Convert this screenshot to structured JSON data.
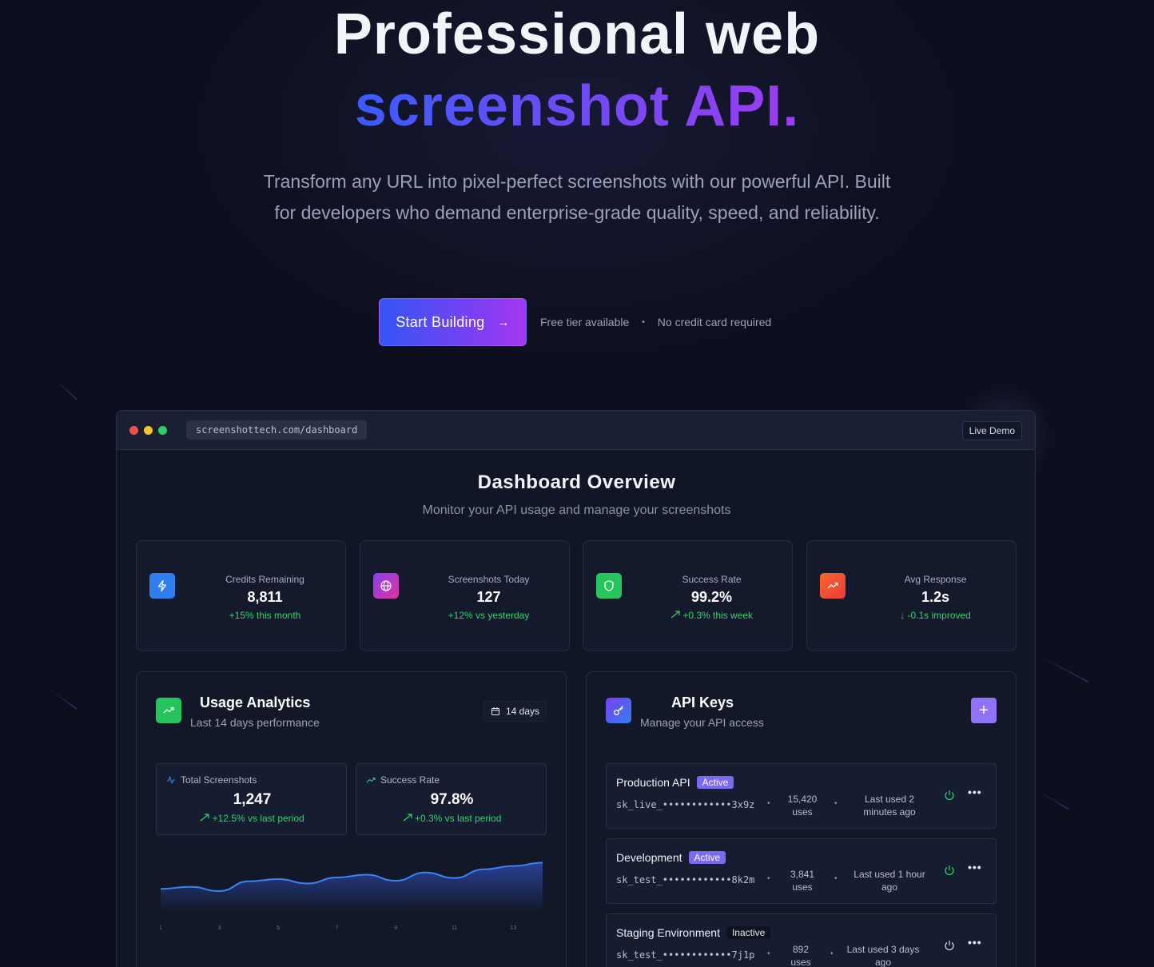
{
  "hero": {
    "title_line1": "Professional web",
    "title_line2": "screenshot API.",
    "subtitle": "Transform any URL into pixel-perfect screenshots with our powerful API. Built for developers who demand enterprise-grade quality, speed, and reliability.",
    "cta_label": "Start Building",
    "cta_arrow": "→",
    "note1": "Free tier available",
    "note_sep": "•",
    "note2": "No credit card required"
  },
  "browser": {
    "url": "screenshottech.com/dashboard",
    "live_demo": "Live Demo",
    "traffic_colors": [
      "#f04e4e",
      "#f4c430",
      "#2fcf67"
    ]
  },
  "dashboard": {
    "title": "Dashboard Overview",
    "subtitle": "Monitor your API usage and manage your screenshots"
  },
  "stats": [
    {
      "label": "Credits Remaining",
      "value": "8,811",
      "change": "+15% this month",
      "icon": "bolt-icon",
      "color": "#2f7ff0"
    },
    {
      "label": "Screenshots Today",
      "value": "127",
      "change": "+12% vs yesterday",
      "icon": "globe-icon",
      "color": "#b93ad8"
    },
    {
      "label": "Success Rate",
      "value": "99.2%",
      "change": "+0.3% this week",
      "icon": "shield-icon",
      "color": "#25c45c"
    },
    {
      "label": "Avg Response",
      "value": "1.2s",
      "change": "-0.1s improved",
      "icon": "trend-icon",
      "color": "#f2542d"
    }
  ],
  "analytics": {
    "title": "Usage Analytics",
    "subtitle": "Last 14 days performance",
    "range_chip": "14 days",
    "cards": [
      {
        "label": "Total Screenshots",
        "value": "1,247",
        "change": "+12.5% vs last period"
      },
      {
        "label": "Success Rate",
        "value": "97.8%",
        "change": "+0.3% vs last period"
      }
    ]
  },
  "chart_data": {
    "type": "area",
    "x": [
      1,
      2,
      3,
      4,
      5,
      6,
      7,
      8,
      9,
      10,
      11,
      12,
      13,
      14
    ],
    "xticks": [
      "1",
      "3",
      "5",
      "7",
      "9",
      "11",
      "13"
    ],
    "values": [
      42,
      46,
      38,
      56,
      60,
      52,
      63,
      68,
      57,
      72,
      62,
      78,
      84,
      90
    ],
    "ylim": [
      0,
      120
    ],
    "color": "#3b82f6"
  },
  "api_keys": {
    "title": "API Keys",
    "subtitle": "Manage your API access",
    "add_label": "+",
    "keys": [
      {
        "name": "Production API",
        "status": "Active",
        "token": "sk_live_••••••••••••3x9z",
        "uses_count": "15,420",
        "uses_label": "uses",
        "last_line1": "Last used 2",
        "last_line2": "minutes ago"
      },
      {
        "name": "Development",
        "status": "Active",
        "token": "sk_test_••••••••••••8k2m",
        "uses_count": "3,841",
        "uses_label": "uses",
        "last_line1": "Last used 1 hour",
        "last_line2": "ago"
      },
      {
        "name": "Staging Environment",
        "status": "Inactive",
        "token": "sk_test_••••••••••••7j1p",
        "uses_count": "892",
        "uses_label": "uses",
        "last_line1": "Last used 3 days",
        "last_line2": "ago"
      }
    ]
  }
}
